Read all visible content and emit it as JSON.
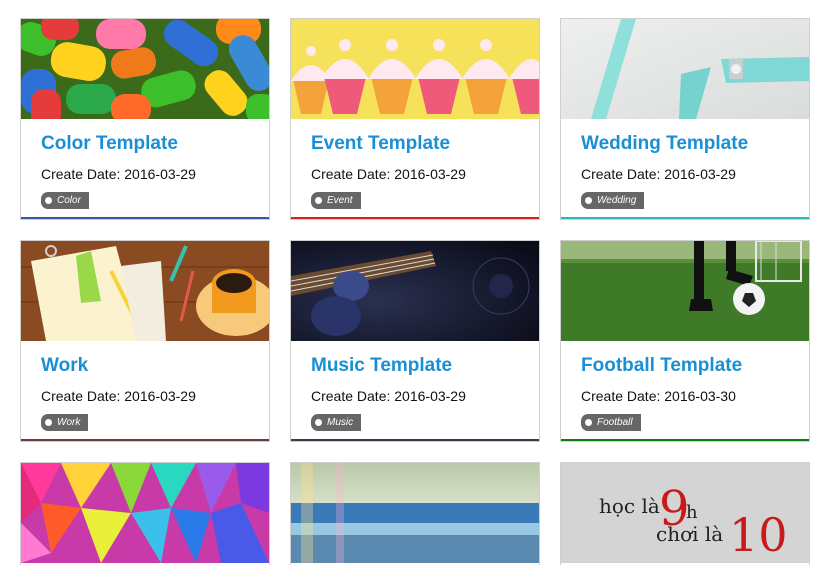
{
  "cards": [
    {
      "title": "Color Template",
      "date": "Create Date: 2016-03-29",
      "tag": "Color",
      "accent": "#3a56a8",
      "image": "jelly-beans-image"
    },
    {
      "title": "Event Template",
      "date": "Create Date: 2016-03-29",
      "tag": "Event",
      "accent": "#e01c1c",
      "image": "cupcakes-image"
    },
    {
      "title": "Wedding Template",
      "date": "Create Date: 2016-03-29",
      "tag": "Wedding",
      "accent": "#2ab8b8",
      "image": "ribbon-image"
    },
    {
      "title": "Work",
      "date": "Create Date: 2016-03-29",
      "tag": "Work",
      "accent": "#6b3b3b",
      "image": "desk-image"
    },
    {
      "title": "Music Template",
      "date": "Create Date: 2016-03-29",
      "tag": "Music",
      "accent": "#3a3a4a",
      "image": "guitar-image"
    },
    {
      "title": "Football Template",
      "date": "Create Date: 2016-03-30",
      "tag": "Football",
      "accent": "#127a12",
      "image": "football-image"
    },
    {
      "image": "polygon-image"
    },
    {
      "image": "beach-image"
    },
    {
      "image": "handwriting-image",
      "image_text_1": "học là",
      "image_text_2": "chơi là",
      "image_num_1": "9",
      "image_num_1b": "h",
      "image_num_2": "10"
    }
  ]
}
